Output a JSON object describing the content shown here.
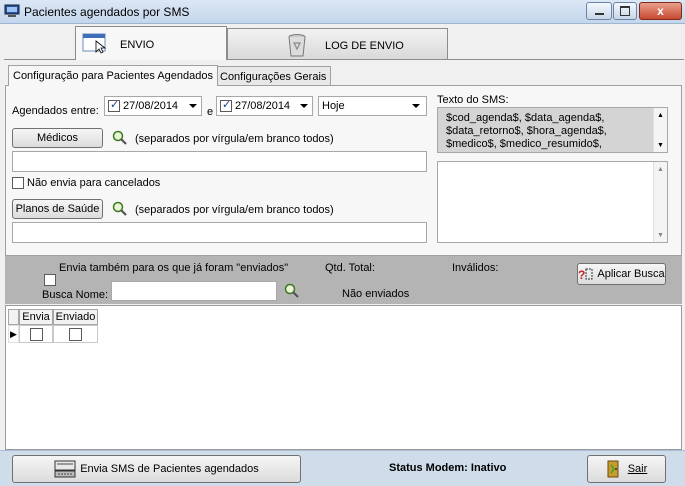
{
  "window": {
    "title": "Pacientes agendados por SMS",
    "controls": [
      "minimize",
      "maximize",
      "close"
    ],
    "close_glyph": "x"
  },
  "tabs": {
    "envio": "ENVIO",
    "log": "LOG DE ENVIO"
  },
  "subtabs": {
    "config": "Configuração para Pacientes Agendados",
    "gerais": "Configurações Gerais"
  },
  "form": {
    "agendados_label": "Agendados entre:",
    "date_from": "27/08/2014",
    "and_label": "e",
    "date_to": "27/08/2014",
    "period": "Hoje",
    "medicos_button": "Médicos",
    "medicos_hint": "(separados por vírgula/em branco todos)",
    "medicos_value": "",
    "nao_envia_cancelados": "Não envia para cancelados",
    "planos_button": "Planos de Saúde",
    "planos_hint": "(separados por vírgula/em branco todos)",
    "planos_value": ""
  },
  "sms": {
    "label": "Texto do SMS:",
    "tags_line1": "$cod_agenda$, $data_agenda$,",
    "tags_line2": "$data_retorno$, $hora_agenda$,",
    "tags_line3": "$medico$, $medico_resumido$,",
    "message": ""
  },
  "filter": {
    "envia_tambem": "Envia também para os que já foram \"enviados\"",
    "qtd_total": "Qtd. Total:",
    "invalidos": "Inválidos:",
    "aplicar_busca": "Aplicar Busca",
    "busca_nome": "Busca Nome:",
    "busca_value": "",
    "nao_enviados": "Não enviados"
  },
  "grid": {
    "columns": [
      "Envia",
      "Enviado"
    ],
    "row_indicator": "▶"
  },
  "footer": {
    "enviar_button": "Envia SMS de Pacientes agendados",
    "status": "Status Modem: Inativo",
    "sair": "Sair"
  },
  "colors": {
    "accent": "#1a3d8a",
    "window_frame": "#cfdcea",
    "close_button": "#c7482e"
  }
}
